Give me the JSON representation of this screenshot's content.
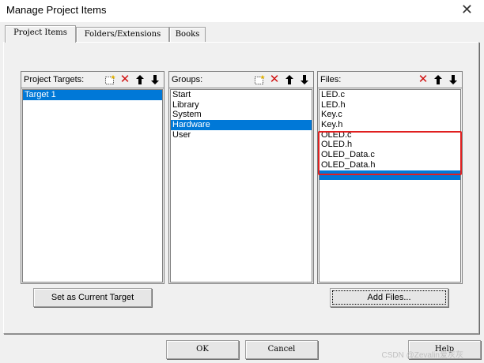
{
  "window": {
    "title": "Manage Project Items",
    "close_glyph": "✕"
  },
  "tabs": [
    {
      "label": "Project Items"
    },
    {
      "label": "Folders/Extensions"
    },
    {
      "label": "Books"
    }
  ],
  "project_targets": {
    "label": "Project Targets:",
    "items": [
      {
        "label": "Target 1",
        "selected": true
      }
    ]
  },
  "groups": {
    "label": "Groups:",
    "items": [
      {
        "label": "Start"
      },
      {
        "label": "Library"
      },
      {
        "label": "System"
      },
      {
        "label": "Hardware",
        "selected": true
      },
      {
        "label": "User"
      }
    ]
  },
  "files": {
    "label": "Files:",
    "items": [
      {
        "label": "LED.c"
      },
      {
        "label": "LED.h"
      },
      {
        "label": "Key.c"
      },
      {
        "label": "Key.h"
      },
      {
        "label": "OLED.c"
      },
      {
        "label": "OLED.h"
      },
      {
        "label": "OLED_Data.c"
      },
      {
        "label": "OLED_Data.h"
      },
      {
        "label": "",
        "selected": true
      }
    ]
  },
  "buttons": {
    "set_current_target": "Set as Current Target",
    "add_files": "Add Files...",
    "ok": "OK",
    "cancel": "Cancel",
    "help": "Help"
  },
  "watermark": "CSDN @Zevalin爱灰灰",
  "icons": {
    "new": "new-item-icon",
    "delete": "delete-icon",
    "up": "move-up-icon",
    "down": "move-down-icon"
  },
  "colors": {
    "selection": "#0078d7",
    "highlight_box": "#e02020",
    "delete_icon": "#d01010"
  }
}
